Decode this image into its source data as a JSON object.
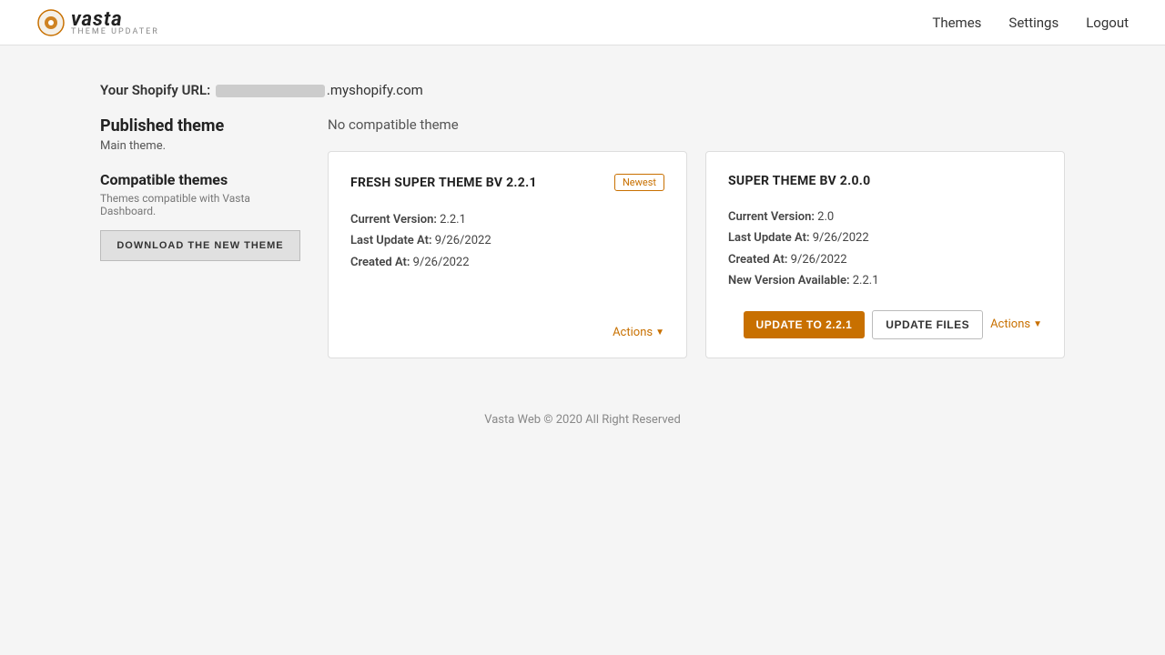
{
  "header": {
    "logo_main": "vasta",
    "logo_sub": "THEME UPDATER",
    "nav": [
      {
        "label": "Themes",
        "href": "#"
      },
      {
        "label": "Settings",
        "href": "#"
      },
      {
        "label": "Logout",
        "href": "#"
      }
    ]
  },
  "shopify": {
    "label": "Your Shopify URL:",
    "url_suffix": ".myshopify.com"
  },
  "sidebar": {
    "published_title": "Published theme",
    "published_sub": "Main theme.",
    "compatible_title": "Compatible themes",
    "compatible_sub": "Themes compatible with Vasta Dashboard.",
    "download_btn": "DOWNLOAD THE NEW THEME"
  },
  "no_compatible": "No compatible theme",
  "themes": [
    {
      "id": "fresh",
      "title": "FRESH SUPER THEME BV 2.2.1",
      "badge": "Newest",
      "current_version_label": "Current Version:",
      "current_version": "2.2.1",
      "last_update_label": "Last Update At:",
      "last_update": "9/26/2022",
      "created_label": "Created At:",
      "created": "9/26/2022",
      "new_version_label": null,
      "new_version": null,
      "actions_label": "Actions"
    },
    {
      "id": "super",
      "title": "SUPER THEME BV 2.0.0",
      "badge": null,
      "current_version_label": "Current Version:",
      "current_version": "2.0",
      "last_update_label": "Last Update At:",
      "last_update": "9/26/2022",
      "created_label": "Created At:",
      "created": "9/26/2022",
      "new_version_label": "New Version Available:",
      "new_version": "2.2.1",
      "update_btn": "UPDATE TO 2.2.1",
      "update_files_btn": "UPDATE FILES",
      "actions_label": "Actions"
    }
  ],
  "footer": "Vasta Web © 2020 All Right Reserved"
}
